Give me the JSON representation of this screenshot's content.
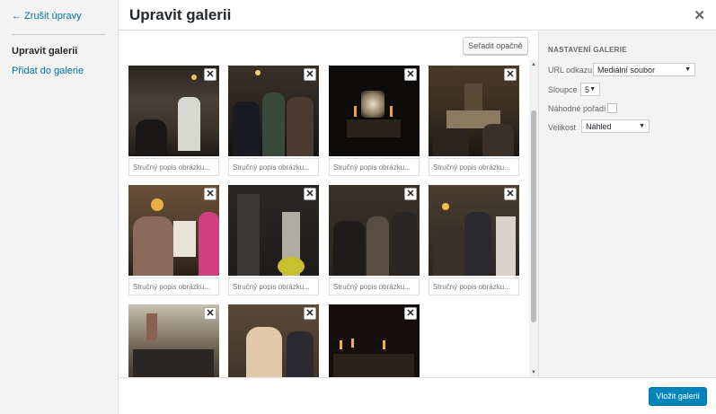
{
  "menu": {
    "cancel_label": "← Zrušit úpravy",
    "active_label": "Upravit galerii",
    "add_label": "Přidat do galerie"
  },
  "header": {
    "title": "Upravit galerii",
    "close_icon": "close-icon"
  },
  "toolbar": {
    "sort_label": "Seřadit opačně"
  },
  "gallery": {
    "remove_icon": "close-icon",
    "caption_placeholder": "Stručný popis obrázku...",
    "items_count_visible": 11
  },
  "settings": {
    "heading": "NASTAVENÍ GALERIE",
    "link_label": "URL odkazu",
    "link_value": "Mediální soubor",
    "columns_label": "Sloupce",
    "columns_value": "5",
    "random_label": "Náhodné pořadí",
    "random_checked": false,
    "size_label": "Velikost",
    "size_value": "Náhled"
  },
  "footer": {
    "insert_label": "Vložit galerii"
  },
  "colors": {
    "primary": "#0085ba",
    "link": "#0073aa"
  }
}
